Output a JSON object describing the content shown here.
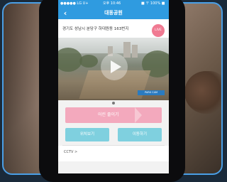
{
  "status_bar": {
    "carrier": "●●●●● LG U+",
    "time": "오후 10:46",
    "battery": "■ 〒 100% ■"
  },
  "header": {
    "title": "대동공원",
    "back_icon": "chevron-left-icon",
    "color": "#2f9be0"
  },
  "location": {
    "address": "경기도 성남시 분당구 하대원동 163번지",
    "badge": "LIVE"
  },
  "camera": {
    "play_icon": "play-icon",
    "stamp": "PARK CAM"
  },
  "actions": {
    "primary_label": "어린 줄이기",
    "primary_color": "#f3a9bd",
    "left_label": "위치보기",
    "right_label": "이동하기",
    "secondary_color": "#7fd0df"
  },
  "bottom": {
    "label": "CCTV >"
  }
}
